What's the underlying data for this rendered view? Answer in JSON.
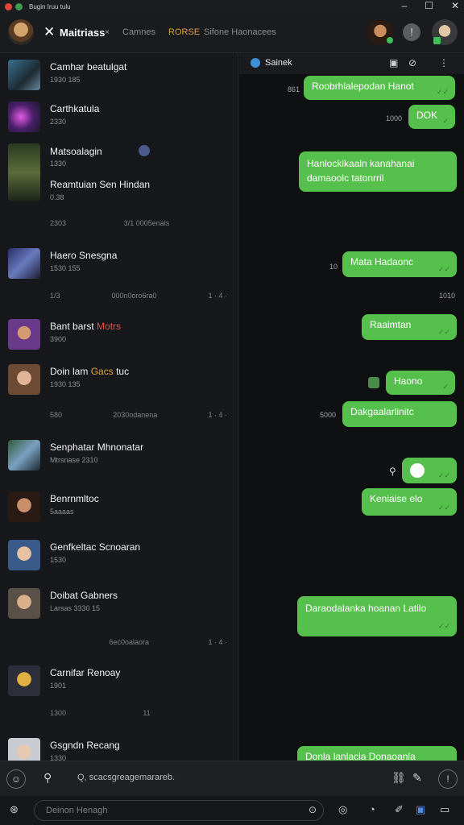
{
  "window": {
    "title": "Bugin Iruu tulu"
  },
  "header": {
    "title": "Maitriass",
    "tabs": [
      "Camnes",
      "RORSE",
      "Sifone Haonacees"
    ]
  },
  "conversations": [
    {
      "name": "Camhar beatulgat",
      "sub": "1930 185"
    },
    {
      "name": "Carthkatula",
      "sub": "2330"
    },
    {
      "name": "Matsoalagin",
      "sub": "1330"
    },
    {
      "name": "Reamtuian Sen Hindan",
      "sub": "0.38"
    },
    {
      "name": "Haero Snesgna",
      "sub": "1530 155"
    },
    {
      "name": "Bant barst",
      "highlight": "Motrs",
      "sub": "3900"
    },
    {
      "name": "Doin lam",
      "highlight": "Gacs",
      "tail": "tuc",
      "sub": "1930 135"
    },
    {
      "name": "Senphatar Mhnonatar",
      "sub": "Mtrsnase 2310"
    },
    {
      "name": "Benrnmltoc",
      "sub": "5aaaas"
    },
    {
      "name": "Genfkeltac Scnoaran",
      "sub": "1530"
    },
    {
      "name": "Doibat Gabners",
      "sub": "Larsas 3330 15"
    },
    {
      "name": "Carnifar Renoay",
      "sub": "1901"
    },
    {
      "name": "Gsgndn Recang",
      "sub": "1330"
    }
  ],
  "meta_rows": [
    {
      "left": "2303",
      "mid": "3/1 0005enals",
      "right": ""
    },
    {
      "left": "1/3",
      "mid": "000n0oro6ra0",
      "right": "1 · 4 ·"
    },
    {
      "left": "580",
      "mid": "2030odanena",
      "right": "1 · 4 ·"
    },
    {
      "left": "",
      "mid": "6ec0oalaora",
      "right": "1 · 4 ·"
    },
    {
      "left": "1300",
      "mid": "11",
      "right": ""
    }
  ],
  "chat": {
    "header_label": "Sainek",
    "messages": [
      {
        "text": "Roobrhlalepodan Hanot",
        "time": "861"
      },
      {
        "text": "DOK",
        "time": "1000"
      },
      {
        "text": "Hanlockikaaln kanahanai damaoolc tatonrril",
        "time": ""
      },
      {
        "text": "Mata Hadaonc",
        "time": "10"
      },
      {
        "text": "",
        "time": "1010"
      },
      {
        "text": "Raaimtan",
        "time": ""
      },
      {
        "text": "Haono",
        "time": ""
      },
      {
        "text": "Dakgaalarlinitc",
        "time": "5000"
      },
      {
        "text": "",
        "time": ""
      },
      {
        "text": "Keniaise elo",
        "time": ""
      },
      {
        "text": "Daraodalanka hoanan Latilo",
        "time": ""
      },
      {
        "text": "Donla lanlacia Donaoanla",
        "time": ""
      }
    ]
  },
  "composer": {
    "hint": "Q, scacsgreagemarareb."
  },
  "bottom": {
    "search_placeholder": "Deinon Henagh"
  }
}
